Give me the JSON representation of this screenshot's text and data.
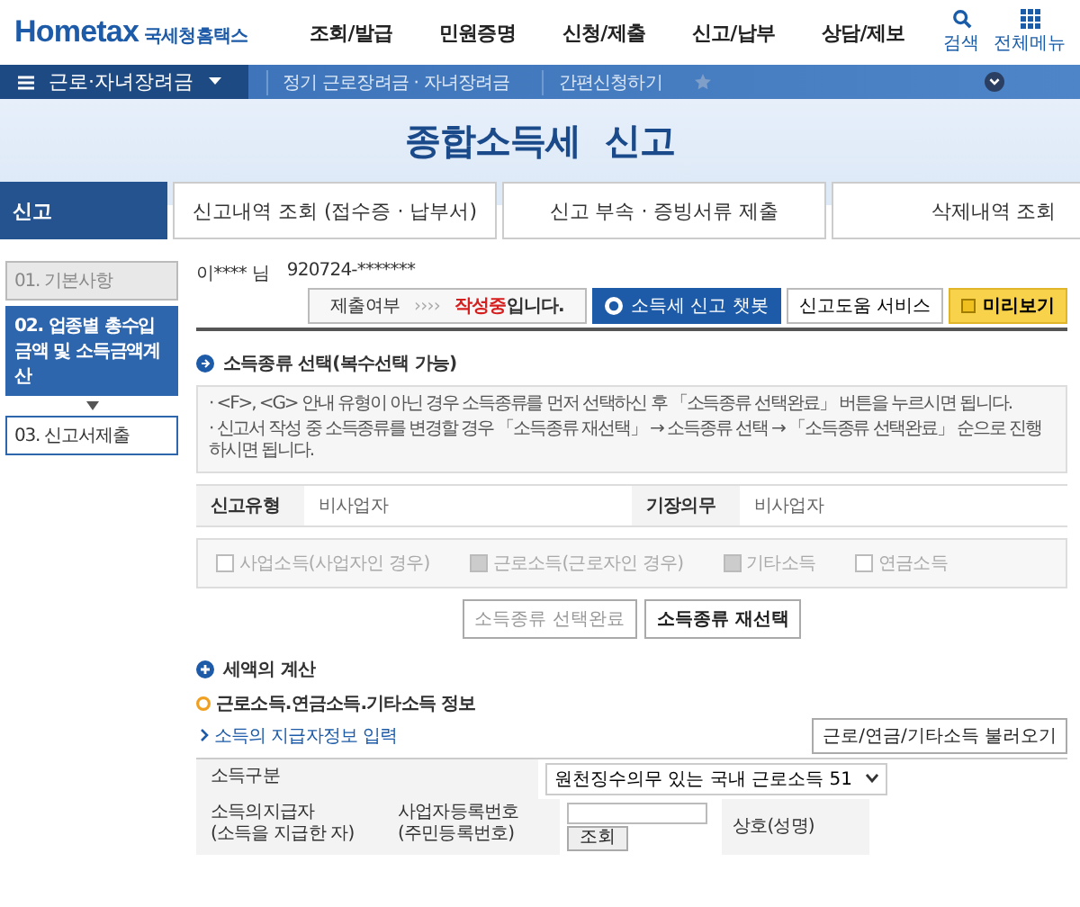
{
  "header": {
    "logo_text": "Hometax",
    "brand": "국세청홈택스",
    "menu": [
      "조회/발급",
      "민원증명",
      "신청/제출",
      "신고/납부",
      "상담/제보"
    ],
    "tools": [
      {
        "kind": "search",
        "label": "검색"
      },
      {
        "kind": "grid",
        "label": "전체메뉴"
      }
    ]
  },
  "nav": {
    "section": "근로·자녀장려금",
    "crumbs": [
      "정기 근로장려금 · 자녀장려금",
      "간편신청하기"
    ]
  },
  "banner": {
    "title": "종합소득세  신고"
  },
  "tabs": [
    {
      "label": "신고",
      "selected": true
    },
    {
      "label": "신고내역 조회 (접수증 · 납부서)",
      "selected": false
    },
    {
      "label": "신고 부속 · 증빙서류 제출",
      "selected": false
    },
    {
      "label": "삭제내역 조회",
      "selected": false
    }
  ],
  "steps": [
    {
      "label": "01. 기본사항",
      "selected": false,
      "disabled": true
    },
    {
      "label": "02. 업종별 총수입금액 및 소득금액계산",
      "selected": true,
      "disabled": false
    },
    {
      "label": "03. 신고서제출",
      "selected": false,
      "disabled": false
    }
  ],
  "user": {
    "name": "이**** 님",
    "id": "920724-*******"
  },
  "submit_status": {
    "label": "제출여부",
    "arrows": "››››",
    "value": "작성중",
    "suffix": "입니다."
  },
  "actions": [
    {
      "kind": "chatbot",
      "label": "소득세 신고 챗봇"
    },
    {
      "kind": "plain",
      "label": "신고도움 서비스"
    },
    {
      "kind": "preview",
      "label": "미리보기"
    }
  ],
  "income_section": {
    "title": "소득종류 선택(복수선택 가능)",
    "notes": [
      "· <F>, <G> 안내 유형이 아닌 경우 소득종류를 먼저 선택하신 후 「소득종류 선택완료」 버튼을 누르시면 됩니다.",
      "· 신고서 작성 중 소득종류를 변경할 경우 「소득종류 재선택」 → 소득종류 선택 → 「소득종류 선택완료」 순으로 진행하시면 됩니다."
    ],
    "fields": [
      {
        "label": "신고유형",
        "value": "비사업자"
      },
      {
        "label": "기장의무",
        "value": "비사업자"
      }
    ],
    "checkboxes": [
      {
        "label": "사업소득(사업자인 경우)",
        "checked": false
      },
      {
        "label": "근로소득(근로자인 경우)",
        "checked": true
      },
      {
        "label": "기타소득",
        "checked": true
      },
      {
        "label": "연금소득",
        "checked": false
      }
    ],
    "buttons": [
      {
        "label": "소득종류 선택완료",
        "disabled": true
      },
      {
        "label": "소득종류 재선택",
        "disabled": false
      }
    ]
  },
  "tax_section": {
    "title": "세액의 계산",
    "subtitle": "근로소득.연금소득.기타소득 정보",
    "link": "소득의 지급자정보 입력",
    "load_button": "근로/연금/기타소득 불러오기",
    "income_type": {
      "label": "소득구분",
      "value": "원천징수의무 있는 국내 근로소득 51"
    },
    "payer": {
      "label": "소득의지급자\n(소득을 지급한 자)",
      "reg_label": "사업자등록번호\n(주민등록번호)",
      "lookup_button": "조회",
      "name_label": "상호(성명)"
    }
  }
}
